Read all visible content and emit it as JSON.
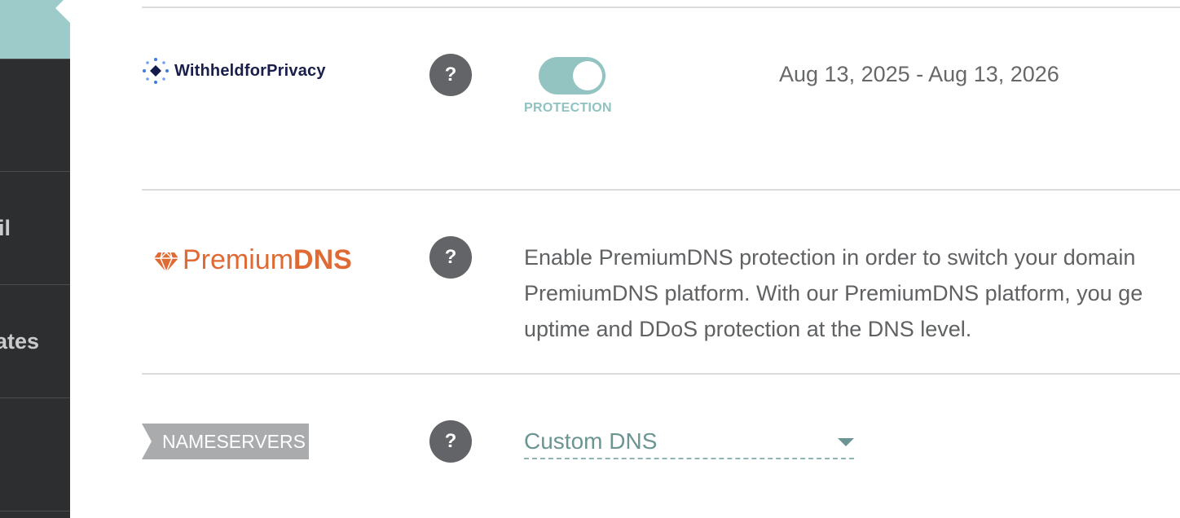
{
  "sidebar": {
    "items": [
      {
        "label": ""
      },
      {
        "label": "il"
      },
      {
        "label": "ates"
      }
    ]
  },
  "rows": {
    "privacy": {
      "logo_text": "WithheldforPrivacy",
      "help": "?",
      "toggle_label": "PROTECTION",
      "toggle_on": true,
      "date_range": "Aug 13, 2025 - Aug 13, 2026"
    },
    "premiumdns": {
      "logo_text_part1": "Premium",
      "logo_text_part2": "DNS",
      "help": "?",
      "description_lines": [
        "Enable PremiumDNS protection in order to switch your domain",
        "PremiumDNS platform. With our PremiumDNS platform, you ge",
        "uptime and DDoS protection at the DNS level."
      ]
    },
    "nameservers": {
      "tag": "NAMESERVERS",
      "help": "?",
      "selected": "Custom DNS"
    }
  },
  "colors": {
    "sidebar_bg": "#2c2e30",
    "active_accent": "#9ccbc9",
    "premiumdns_brand": "#e06a34",
    "toggle_on": "#93c4c2"
  }
}
